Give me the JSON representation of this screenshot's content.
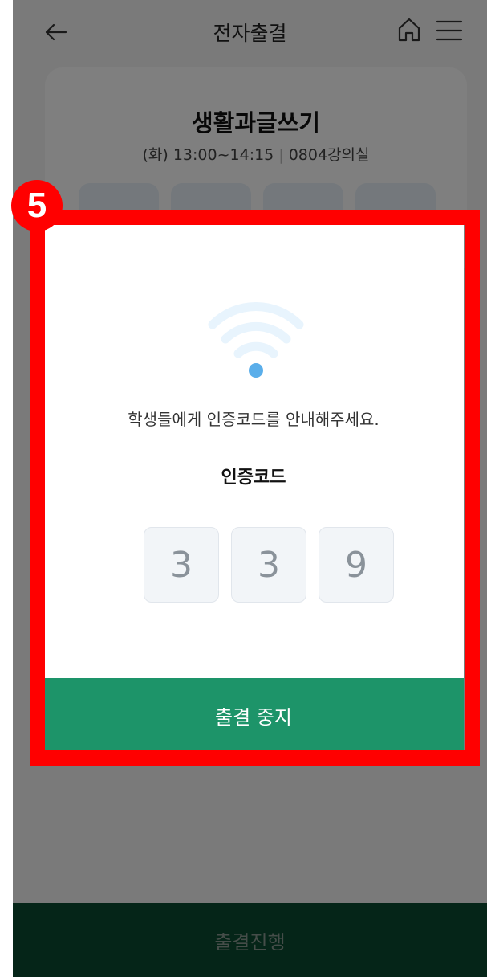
{
  "header": {
    "title": "전자출결",
    "back_icon": "arrow-left-icon",
    "home_icon": "home-icon",
    "menu_icon": "hamburger-menu-icon"
  },
  "course": {
    "title": "생활과글쓰기",
    "schedule": "(화) 13:00~14:15",
    "room": "0804강의실"
  },
  "modal": {
    "icon": "wifi-signal-icon",
    "message": "학생들에게 인증코드를 안내해주세요.",
    "code_label": "인증코드",
    "code_digits": [
      "3",
      "3",
      "9"
    ],
    "stop_button_label": "출결 중지"
  },
  "bottom_button": {
    "label": "출결진행"
  },
  "annotation": {
    "step_number": "5",
    "highlight_color": "#ff0000"
  },
  "colors": {
    "primary_green": "#1d9469",
    "dark_green": "#0a4a30",
    "wifi_blue": "#5aaeea"
  }
}
